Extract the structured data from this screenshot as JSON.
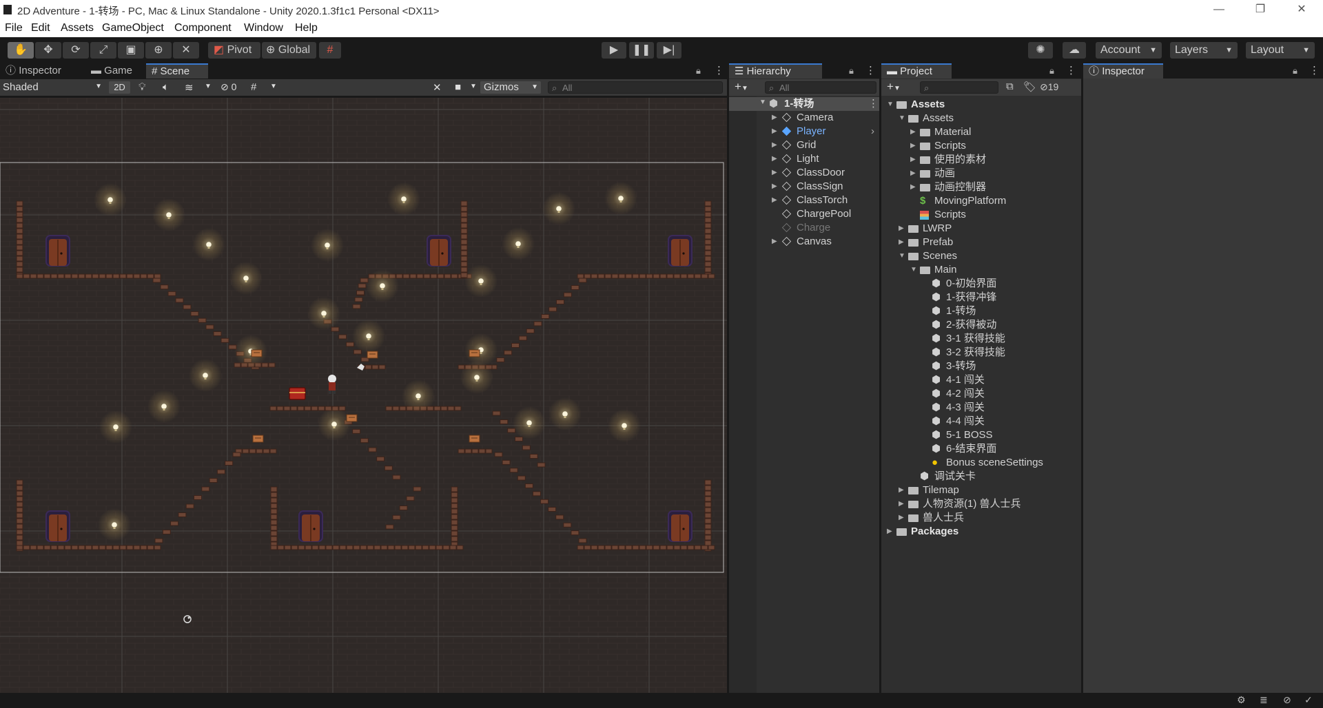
{
  "window": {
    "title": "2D Adventure - 1-转场 - PC, Mac & Linux Standalone - Unity 2020.1.3f1c1 Personal <DX11>",
    "controls": [
      "—",
      "❐",
      "✕"
    ]
  },
  "menu": [
    "File",
    "Edit",
    "Assets",
    "GameObject",
    "Component",
    "Window",
    "Help"
  ],
  "toolbar": {
    "tools": [
      "hand-tool",
      "move-tool",
      "rotate-tool",
      "scale-tool",
      "rect-tool",
      "transform-tool",
      "custom-tool"
    ],
    "pivot": "Pivot",
    "global": "Global",
    "account": "Account",
    "layers": "Layers",
    "layout": "Layout"
  },
  "left_tabs": [
    "Inspector",
    "Game",
    "Scene"
  ],
  "scene_bar": {
    "shading": "Shaded",
    "mode_2d": "2D",
    "hidden_count": "0",
    "gizmos": "Gizmos",
    "search_placeholder": "All"
  },
  "hierarchy": {
    "tab": "Hierarchy",
    "search_placeholder": "All",
    "scene_name": "1-转场",
    "items": [
      {
        "label": "Camera",
        "expandable": true,
        "state": "normal"
      },
      {
        "label": "Player",
        "expandable": true,
        "state": "prefab"
      },
      {
        "label": "Grid",
        "expandable": true,
        "state": "normal"
      },
      {
        "label": "Light",
        "expandable": true,
        "state": "normal"
      },
      {
        "label": "ClassDoor",
        "expandable": true,
        "state": "normal"
      },
      {
        "label": "ClassSign",
        "expandable": true,
        "state": "normal"
      },
      {
        "label": "ClassTorch",
        "expandable": true,
        "state": "normal"
      },
      {
        "label": "ChargePool",
        "expandable": false,
        "state": "normal"
      },
      {
        "label": "Charge",
        "expandable": false,
        "state": "disabled"
      },
      {
        "label": "Canvas",
        "expandable": true,
        "state": "normal"
      }
    ]
  },
  "project": {
    "tab": "Project",
    "hidden_count": "19",
    "tree": [
      {
        "label": "Assets",
        "depth": 0,
        "fold": "open",
        "icon": "folder",
        "bold": true
      },
      {
        "label": "Assets",
        "depth": 1,
        "fold": "open",
        "icon": "folder"
      },
      {
        "label": "Material",
        "depth": 2,
        "fold": "closed",
        "icon": "folder"
      },
      {
        "label": "Scripts",
        "depth": 2,
        "fold": "closed",
        "icon": "folder"
      },
      {
        "label": "使用的素材",
        "depth": 2,
        "fold": "closed",
        "icon": "folder"
      },
      {
        "label": "动画",
        "depth": 2,
        "fold": "closed",
        "icon": "folder"
      },
      {
        "label": "动画控制器",
        "depth": 2,
        "fold": "closed",
        "icon": "folder"
      },
      {
        "label": "MovingPlatform",
        "depth": 2,
        "fold": "none",
        "icon": "script"
      },
      {
        "label": "Scripts",
        "depth": 2,
        "fold": "none",
        "icon": "asset"
      },
      {
        "label": "LWRP",
        "depth": 1,
        "fold": "closed",
        "icon": "folder"
      },
      {
        "label": "Prefab",
        "depth": 1,
        "fold": "closed",
        "icon": "folder"
      },
      {
        "label": "Scenes",
        "depth": 1,
        "fold": "open",
        "icon": "folder"
      },
      {
        "label": "Main",
        "depth": 2,
        "fold": "open",
        "icon": "folder"
      },
      {
        "label": "0-初始界面",
        "depth": 3,
        "fold": "none",
        "icon": "scene"
      },
      {
        "label": "1-获得冲锋",
        "depth": 3,
        "fold": "none",
        "icon": "scene"
      },
      {
        "label": "1-转场",
        "depth": 3,
        "fold": "none",
        "icon": "scene"
      },
      {
        "label": "2-获得被动",
        "depth": 3,
        "fold": "none",
        "icon": "scene"
      },
      {
        "label": "3-1 获得技能",
        "depth": 3,
        "fold": "none",
        "icon": "scene"
      },
      {
        "label": "3-2 获得技能",
        "depth": 3,
        "fold": "none",
        "icon": "scene"
      },
      {
        "label": "3-转场",
        "depth": 3,
        "fold": "none",
        "icon": "scene"
      },
      {
        "label": "4-1 闯关",
        "depth": 3,
        "fold": "none",
        "icon": "scene"
      },
      {
        "label": "4-2 闯关",
        "depth": 3,
        "fold": "none",
        "icon": "scene"
      },
      {
        "label": "4-3 闯关",
        "depth": 3,
        "fold": "none",
        "icon": "scene"
      },
      {
        "label": "4-4 闯关",
        "depth": 3,
        "fold": "none",
        "icon": "scene"
      },
      {
        "label": "5-1 BOSS",
        "depth": 3,
        "fold": "none",
        "icon": "scene"
      },
      {
        "label": "6-结束界面",
        "depth": 3,
        "fold": "none",
        "icon": "scene"
      },
      {
        "label": "Bonus sceneSettings",
        "depth": 3,
        "fold": "none",
        "icon": "lighting"
      },
      {
        "label": "调试关卡",
        "depth": 2,
        "fold": "none",
        "icon": "scene"
      },
      {
        "label": "Tilemap",
        "depth": 1,
        "fold": "closed",
        "icon": "folder"
      },
      {
        "label": "人物资源(1) 兽人士兵",
        "depth": 1,
        "fold": "closed",
        "icon": "folder"
      },
      {
        "label": "兽人士兵",
        "depth": 1,
        "fold": "closed",
        "icon": "folder"
      },
      {
        "label": "Packages",
        "depth": 0,
        "fold": "closed",
        "icon": "folder",
        "bold": true
      }
    ]
  },
  "inspector_right": {
    "tab": "Inspector"
  },
  "colors": {
    "accent_blue": "#3a79d0",
    "player_blue": "#7ab3ff",
    "scene_bg": "#2f2927",
    "brick": "#6b4434",
    "torch_glow": "#f2e6b0"
  }
}
